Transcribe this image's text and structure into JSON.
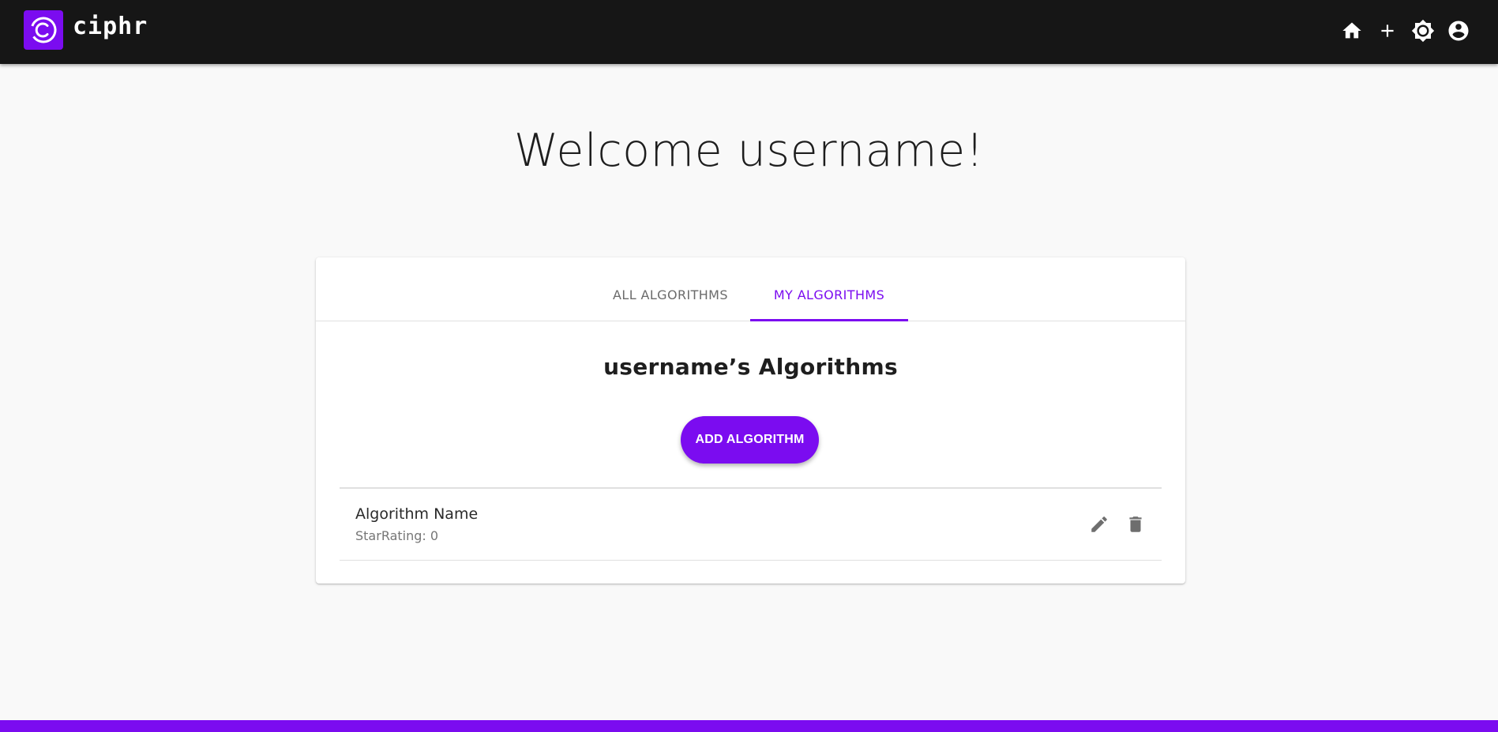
{
  "app": {
    "brand": "ciphr",
    "logo_icon": "ciphr-logo-icon",
    "accent_color": "#7b0cf0",
    "appbar_color": "#161616"
  },
  "nav": {
    "icons": [
      "home-icon",
      "add-icon",
      "theme-brightness-icon",
      "account-circle-icon"
    ]
  },
  "welcome": {
    "title": "Welcome username!"
  },
  "tabs": [
    {
      "label": "ALL ALGORITHMS",
      "active": false
    },
    {
      "label": "MY ALGORITHMS",
      "active": true
    }
  ],
  "section": {
    "title": "username’s Algorithms",
    "add_button": "ADD ALGORITHM"
  },
  "algorithms": [
    {
      "name": "Algorithm Name",
      "rating": "StarRating: 0",
      "actions": [
        "edit-icon",
        "delete-icon"
      ]
    }
  ]
}
